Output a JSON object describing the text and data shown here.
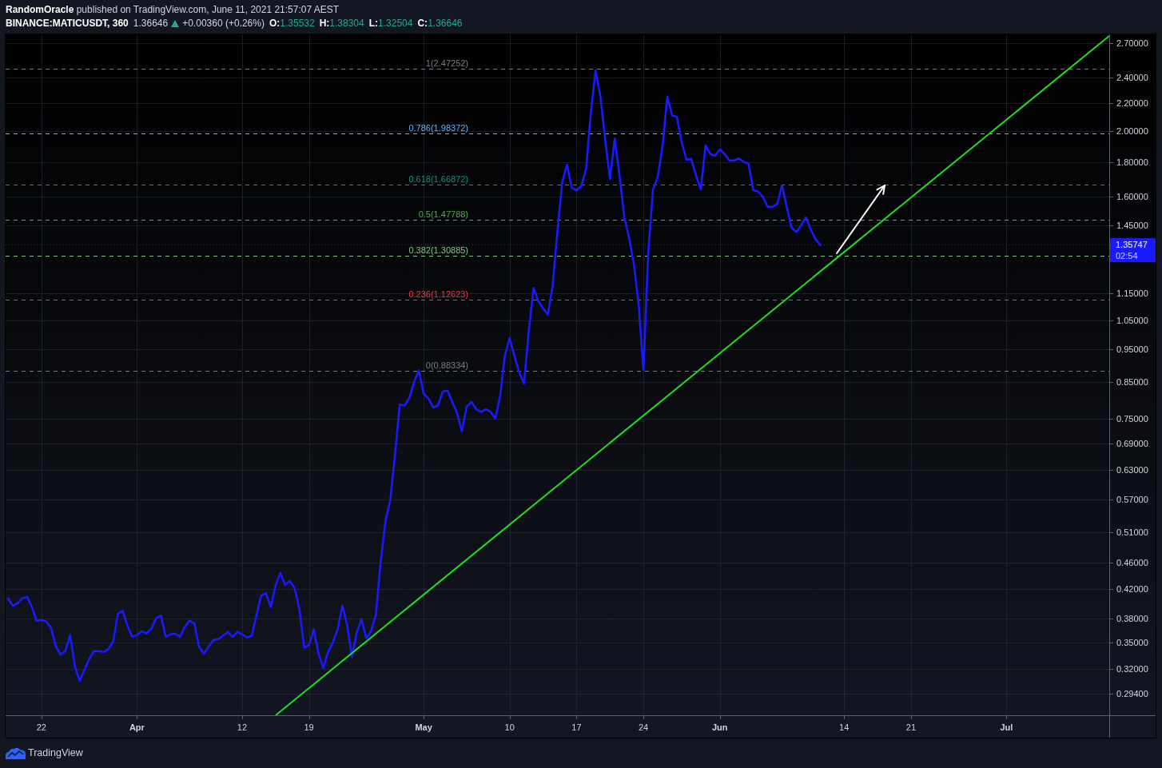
{
  "header": {
    "publish_line": "**RandomOracle** published on TradingView.com, June 11, 2021 21:57:07 AEST"
  },
  "symbol_bar": {
    "symbol": "BINANCE:MATICUSDT, 360",
    "last": "1.36646",
    "rising": true,
    "change": "+0.00360 (+0.26%)",
    "ohlc": [
      {
        "label": "O:",
        "value": "1.35532"
      },
      {
        "label": "H:",
        "value": "1.38304"
      },
      {
        "label": "L:",
        "value": "1.32504"
      },
      {
        "label": "C:",
        "value": "1.36646"
      }
    ]
  },
  "chart": {
    "price_tag": {
      "price": "1.35747",
      "countdown": "02:54"
    },
    "chart_data": {
      "type": "line",
      "log": true,
      "grid": true,
      "categories": [
        null,
        null,
        null,
        null,
        null,
        null,
        null,
        "22",
        null,
        null,
        null,
        null,
        null,
        null,
        null,
        null,
        null,
        null,
        null,
        null,
        null,
        null,
        null,
        null,
        null,
        null,
        null,
        "**Apr**",
        null,
        null,
        null,
        null,
        null,
        null,
        null,
        null,
        null,
        null,
        null,
        null,
        null,
        null,
        null,
        null,
        null,
        null,
        null,
        null,
        null,
        "12",
        null,
        null,
        null,
        null,
        null,
        null,
        null,
        null,
        null,
        null,
        null,
        null,
        null,
        "19",
        null,
        null,
        null,
        null,
        null,
        null,
        null,
        null,
        null,
        null,
        null,
        null,
        null,
        null,
        null,
        null,
        null,
        null,
        null,
        null,
        null,
        null,
        null,
        "**May**",
        null,
        null,
        null,
        null,
        null,
        null,
        null,
        null,
        null,
        null,
        null,
        null,
        null,
        null,
        null,
        null,
        null,
        "10",
        null,
        null,
        null,
        null,
        null,
        null,
        null,
        null,
        null,
        null,
        null,
        null,
        null,
        "17",
        null,
        null,
        null,
        null,
        null,
        null,
        null,
        null,
        null,
        null,
        null,
        null,
        null,
        "24",
        null,
        null,
        null,
        null,
        null,
        null,
        null,
        null,
        null,
        null,
        null,
        null,
        null,
        null,
        null,
        "**Jun**",
        null,
        null,
        null,
        null,
        null,
        null,
        null,
        null,
        null,
        null,
        null,
        null,
        null,
        null,
        null,
        null,
        null,
        null,
        null,
        null,
        null,
        null,
        null,
        null,
        null,
        "14",
        null,
        null,
        null,
        null,
        null,
        null,
        null,
        null,
        null,
        null,
        null,
        null,
        null,
        "21",
        null,
        null,
        null,
        null,
        null,
        null,
        null,
        null,
        null,
        null,
        null,
        null,
        null,
        null,
        null,
        null,
        null,
        null,
        null,
        "**Jul**",
        null,
        null,
        null,
        null,
        null,
        null,
        null,
        null,
        null,
        null,
        null,
        null,
        null,
        null,
        null,
        null,
        null,
        null,
        null,
        null,
        null
      ],
      "series": [
        {
          "color": "#1a1aff",
          "values": [
            0.407,
            0.397,
            0.4,
            0.407,
            0.409,
            0.395,
            0.377,
            0.378,
            0.376,
            0.368,
            0.346,
            0.336,
            0.34,
            0.359,
            0.323,
            0.307,
            0.319,
            0.331,
            0.34,
            0.34,
            0.339,
            0.342,
            0.351,
            0.386,
            0.39,
            0.371,
            0.357,
            0.359,
            0.364,
            0.361,
            0.367,
            0.38,
            0.384,
            0.357,
            0.36,
            0.361,
            0.357,
            0.369,
            0.377,
            0.374,
            0.345,
            0.337,
            0.345,
            0.353,
            0.354,
            0.358,
            0.363,
            0.357,
            0.363,
            0.36,
            0.356,
            0.358,
            0.384,
            0.411,
            0.414,
            0.395,
            0.425,
            0.444,
            0.426,
            0.432,
            0.421,
            0.392,
            0.344,
            0.347,
            0.366,
            0.337,
            0.321,
            0.339,
            0.35,
            0.366,
            0.397,
            0.371,
            0.333,
            0.362,
            0.379,
            0.355,
            0.364,
            0.384,
            0.46,
            0.529,
            0.568,
            0.662,
            0.788,
            0.785,
            0.805,
            0.85,
            0.885,
            0.818,
            0.804,
            0.78,
            0.785,
            0.823,
            0.826,
            0.795,
            0.765,
            0.719,
            0.782,
            0.795,
            0.775,
            0.768,
            0.775,
            0.769,
            0.751,
            0.81,
            0.93,
            0.988,
            0.93,
            0.88,
            0.846,
            1.01,
            1.173,
            1.121,
            1.093,
            1.07,
            1.18,
            1.42,
            1.68,
            1.784,
            1.65,
            1.634,
            1.659,
            1.76,
            2.13,
            2.461,
            2.25,
            1.942,
            1.7,
            1.95,
            1.72,
            1.49,
            1.39,
            1.27,
            1.111,
            0.886,
            1.32,
            1.64,
            1.71,
            1.9,
            2.25,
            2.11,
            2.1,
            1.93,
            1.814,
            1.82,
            1.72,
            1.64,
            1.906,
            1.85,
            1.839,
            1.88,
            1.85,
            1.81,
            1.81,
            1.823,
            1.8,
            1.792,
            1.635,
            1.628,
            1.6,
            1.545,
            1.545,
            1.56,
            1.663,
            1.545,
            1.44,
            1.418,
            1.45,
            1.491,
            1.432,
            1.385,
            1.35747,
            null,
            null,
            null,
            null,
            null,
            null,
            null,
            null,
            null,
            null,
            null,
            null,
            null,
            null,
            null,
            null,
            null,
            null,
            null,
            null,
            null,
            null,
            null,
            null,
            null,
            null,
            null,
            null,
            null,
            null,
            null,
            null,
            null,
            null,
            null,
            null,
            null,
            null,
            null,
            null,
            null,
            null,
            null,
            null,
            null,
            null,
            null,
            null,
            null,
            null,
            null,
            null,
            null,
            null,
            null,
            null,
            null,
            null,
            null,
            null
          ]
        }
      ],
      "ylim": [
        0.2732,
        2.782
      ],
      "yticks": [
        {
          "value": 2.7,
          "label": "2.70000"
        },
        {
          "value": 2.4,
          "label": "2.40000"
        },
        {
          "value": 2.2,
          "label": "2.20000"
        },
        {
          "value": 2.0,
          "label": "2.00000"
        },
        {
          "value": 1.8,
          "label": "1.80000"
        },
        {
          "value": 1.6,
          "label": "1.60000"
        },
        {
          "value": 1.45,
          "label": "1.45000"
        },
        {
          "value": 1.15,
          "label": "1.15000"
        },
        {
          "value": 1.05,
          "label": "1.05000"
        },
        {
          "value": 0.95,
          "label": "0.95000"
        },
        {
          "value": 0.85,
          "label": "0.85000"
        },
        {
          "value": 0.75,
          "label": "0.75000"
        },
        {
          "value": 0.69,
          "label": "0.69000"
        },
        {
          "value": 0.63,
          "label": "0.63000"
        },
        {
          "value": 0.57,
          "label": "0.57000"
        },
        {
          "value": 0.51,
          "label": "0.51000"
        },
        {
          "value": 0.46,
          "label": "0.46000"
        },
        {
          "value": 0.42,
          "label": "0.42000"
        },
        {
          "value": 0.38,
          "label": "0.38000"
        },
        {
          "value": 0.35,
          "label": "0.35000"
        },
        {
          "value": 0.32,
          "label": "0.32000"
        },
        {
          "value": 0.294,
          "label": "0.29400"
        }
      ],
      "ref_lines": [
        {
          "axis": "y",
          "value": 2.47252,
          "label": "1(2.47252)",
          "color": "#787b86"
        },
        {
          "axis": "y",
          "value": 1.98372,
          "label": "0.786(1.98372)",
          "color": "#64b5f6"
        },
        {
          "axis": "y",
          "value": 1.66872,
          "label": "0.618(1.66872)",
          "color": "#089981"
        },
        {
          "axis": "y",
          "value": 1.47788,
          "label": "0.5(1.47788)",
          "color": "#4caf50"
        },
        {
          "axis": "y",
          "value": 1.30885,
          "label": "0.382(1.30885)",
          "color": "#81c784"
        },
        {
          "axis": "y",
          "value": 1.12623,
          "label": "0.236(1.12623)",
          "color": "#f23645"
        },
        {
          "axis": "y",
          "value": 0.88334,
          "label": "0(0.88334)",
          "color": "#787b86"
        }
      ]
    }
  },
  "footer": {
    "brand": "TradingView"
  }
}
